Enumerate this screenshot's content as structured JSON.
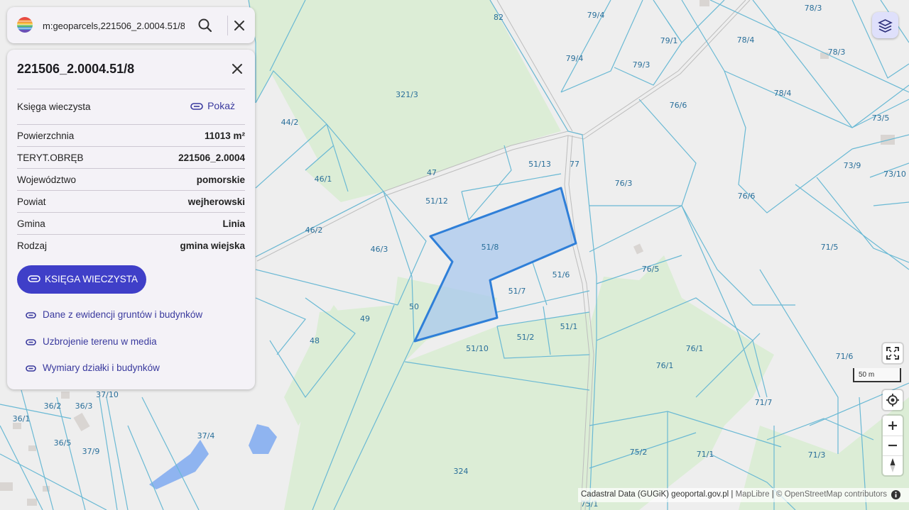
{
  "search": {
    "value": "m:geoparcels,221506_2.0004.51/8"
  },
  "panel": {
    "title": "221506_2.0004.51/8",
    "kw_label": "Księga wieczysta",
    "kw_link": "Pokaż",
    "rows": [
      {
        "key": "Powierzchnia",
        "value": "11013 m²"
      },
      {
        "key": "TERYT.OBRĘB",
        "value": "221506_2.0004"
      },
      {
        "key": "Województwo",
        "value": "pomorskie"
      },
      {
        "key": "Powiat",
        "value": "wejherowski"
      },
      {
        "key": "Gmina",
        "value": "Linia"
      },
      {
        "key": "Rodzaj",
        "value": "gmina wiejska"
      }
    ],
    "main_button": "KSIĘGA WIECZYSTA",
    "links": [
      "Dane z ewidencji gruntów i budynków",
      "Uzbrojenie terenu w media",
      "Wymiary działki i budynków"
    ]
  },
  "map": {
    "parcel_labels": [
      "82",
      "79/4",
      "79/1",
      "79/4",
      "79/3",
      "78/3",
      "78/4",
      "78/3",
      "78/4",
      "321/3",
      "76/6",
      "73/5",
      "44/2",
      "51/13",
      "77",
      "76/3",
      "73/9",
      "73/10",
      "47",
      "46/1",
      "51/12",
      "76/6",
      "46/2",
      "46/3",
      "51/8",
      "71/5",
      "76/5",
      "51/6",
      "51/7",
      "50",
      "49",
      "51/1",
      "51/2",
      "48",
      "51/10",
      "76/1",
      "76/1",
      "71/6",
      "37/10",
      "36/2",
      "36/3",
      "36/1",
      "71/7",
      "37/4",
      "36/5",
      "37/9",
      "75/2",
      "71/1",
      "71/3",
      "324",
      "75/1"
    ],
    "selected_parcel": "51/8",
    "colors": {
      "parcel_fill": "#a9c8ee",
      "parcel_stroke": "#2f7fd8",
      "forest": "#dcedd6",
      "boundary": "#6ab9d4",
      "water": "#8fb4f0"
    }
  },
  "scale": {
    "label": "50 m"
  },
  "attribution": {
    "source": "Cadastral Data (GUGiK) geoportal.gov.pl",
    "maplibre": "MapLibre",
    "osm": "© OpenStreetMap contributors"
  }
}
